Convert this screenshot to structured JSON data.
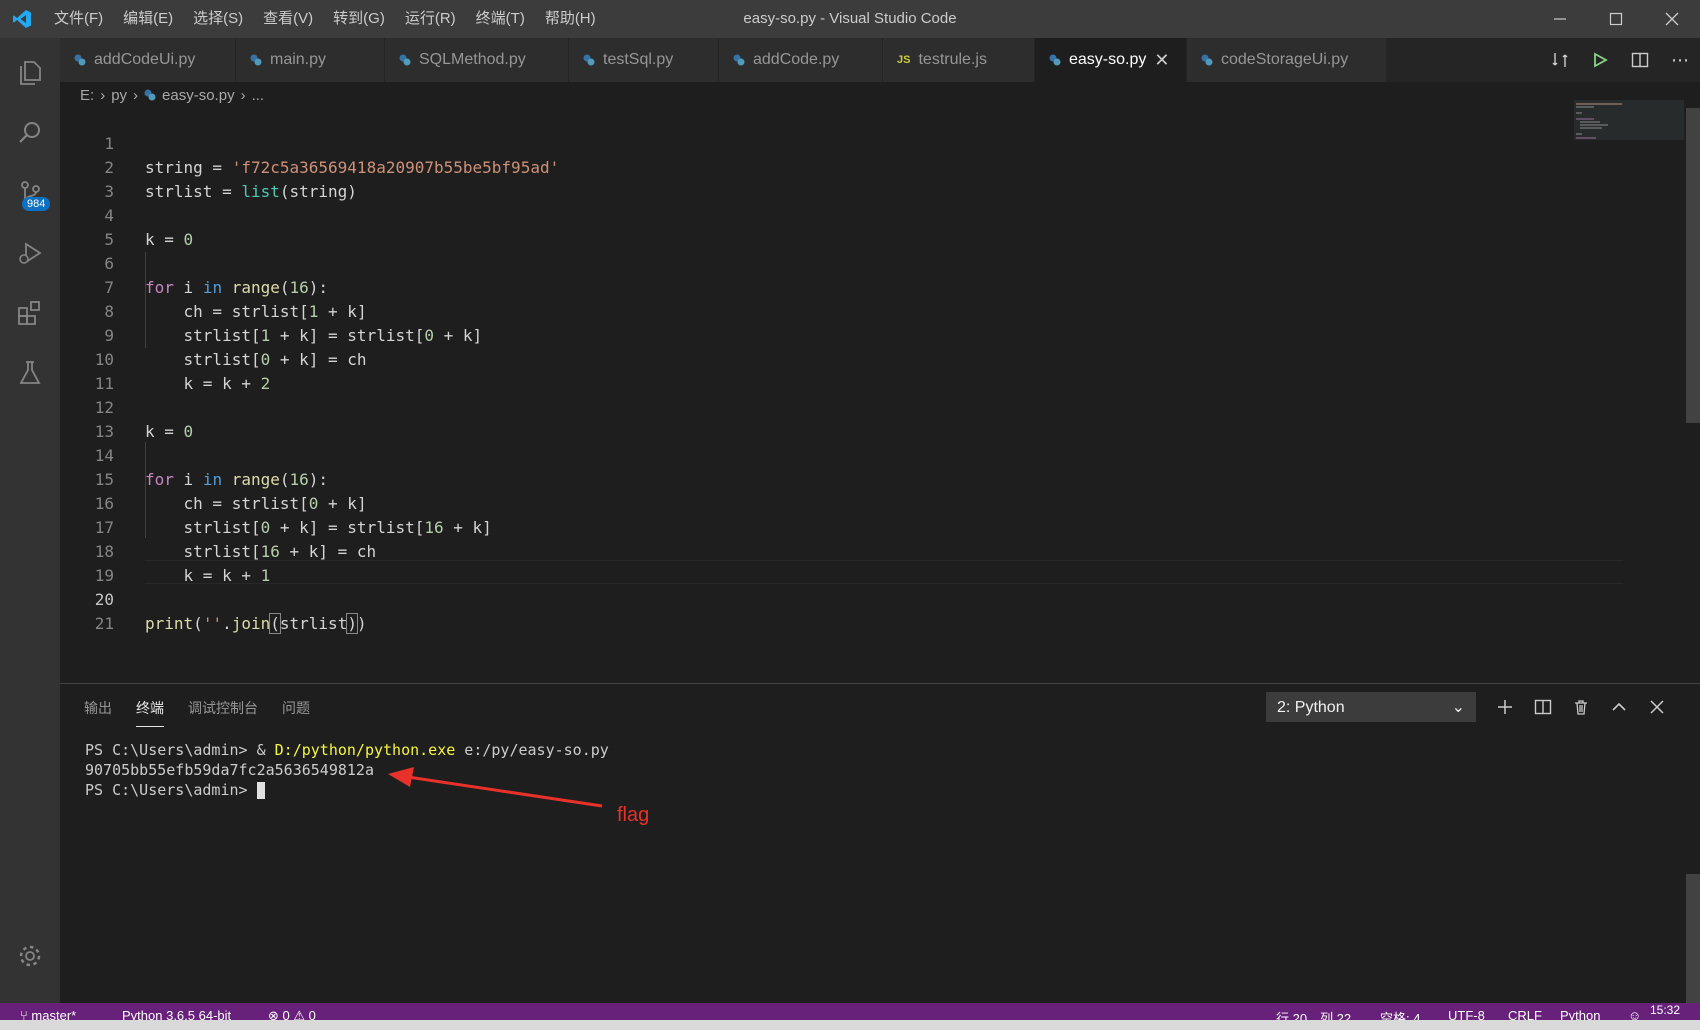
{
  "window": {
    "title": "easy-so.py - Visual Studio Code"
  },
  "menu": [
    "文件(F)",
    "编辑(E)",
    "选择(S)",
    "查看(V)",
    "转到(G)",
    "运行(R)",
    "终端(T)",
    "帮助(H)"
  ],
  "activity": {
    "source_control_badge": "984",
    "items": [
      "explorer-icon",
      "search-icon",
      "source-control-icon",
      "run-debug-icon",
      "extensions-icon",
      "testing-icon",
      "gear-icon"
    ]
  },
  "tabs": [
    {
      "label": "addCodeUi.py",
      "icon": "python-file-icon"
    },
    {
      "label": "main.py",
      "icon": "python-file-icon"
    },
    {
      "label": "SQLMethod.py",
      "icon": "python-file-icon"
    },
    {
      "label": "testSql.py",
      "icon": "python-file-icon"
    },
    {
      "label": "addCode.py",
      "icon": "python-file-icon"
    },
    {
      "label": "testrule.js",
      "icon": "js-file-icon"
    },
    {
      "label": "easy-so.py",
      "icon": "python-file-icon",
      "active": true
    },
    {
      "label": "codeStorageUi.py",
      "icon": "python-file-icon"
    }
  ],
  "breadcrumb": [
    "E:",
    "py",
    "easy-so.py",
    "..."
  ],
  "code": {
    "line_numbers": [
      "1",
      "2",
      "3",
      "4",
      "5",
      "6",
      "7",
      "8",
      "9",
      "10",
      "11",
      "12",
      "13",
      "14",
      "15",
      "16",
      "17",
      "18",
      "19",
      "20",
      "21"
    ],
    "l1": {
      "a": "string = ",
      "b": "'f72c5a36569418a20907b55be5bf95ad'"
    },
    "l2": {
      "a": "strlist = ",
      "b": "list",
      "c": "(string)"
    },
    "l4": {
      "a": "k = ",
      "b": "0"
    },
    "l6": {
      "a": "for",
      "b": " i ",
      "c": "in",
      "d": " ",
      "e": "range",
      "f": "(",
      "g": "16",
      "h": "):"
    },
    "l7": {
      "a": "    ch = strlist[",
      "b": "1",
      "c": " + k]"
    },
    "l8": {
      "a": "    strlist[",
      "b": "1",
      "c": " + k] = strlist[",
      "d": "0",
      "e": " + k]"
    },
    "l9": {
      "a": "    strlist[",
      "b": "0",
      "c": " + k] = ch"
    },
    "l10": {
      "a": "    k = k + ",
      "b": "2"
    },
    "l12": {
      "a": "k = ",
      "b": "0"
    },
    "l14": {
      "a": "for",
      "b": " i ",
      "c": "in",
      "d": " ",
      "e": "range",
      "f": "(",
      "g": "16",
      "h": "):"
    },
    "l15": {
      "a": "    ch = strlist[",
      "b": "0",
      "c": " + k]"
    },
    "l16": {
      "a": "    strlist[",
      "b": "0",
      "c": " + k] = strlist[",
      "d": "16",
      "e": " + k]"
    },
    "l17": {
      "a": "    strlist[",
      "b": "16",
      "c": " + k] = ch"
    },
    "l18": {
      "a": "    k = k + ",
      "b": "1"
    },
    "l20": {
      "a": "print",
      "b": "(",
      "c": "''",
      "d": ".",
      "e": "join",
      "f": "(",
      "g": "strlist",
      "h": ")",
      "i": ")"
    }
  },
  "panel": {
    "tabs": [
      "输出",
      "终端",
      "调试控制台",
      "问题"
    ],
    "active_tab": "终端",
    "terminal_select": "2: Python",
    "terminal": {
      "line1_prompt": "PS C:\\Users\\admin> & ",
      "line1_exe": "D:/python/python.exe",
      "line1_arg": " e:/py/easy-so.py",
      "line2": "90705bb55efb59da7fc2a5636549812a",
      "line3_prompt": "PS C:\\Users\\admin> "
    }
  },
  "annotation": {
    "label": "flag",
    "color": "#e8312a"
  },
  "status": {
    "branch": "master*",
    "python": "Python 3.6.5 64-bit",
    "problems": "⊗ 0 ⚠ 0",
    "position": "行 20，列 22",
    "spaces": "空格: 4",
    "encoding": "UTF-8",
    "eol": "CRLF",
    "language": "Python",
    "time": "15:32"
  },
  "colors": {
    "accent": "#007acc",
    "statusbar": "#68217a",
    "keyword": "#c586c0",
    "string": "#ce9178",
    "number": "#b5cea8",
    "function": "#dcdcaa"
  }
}
